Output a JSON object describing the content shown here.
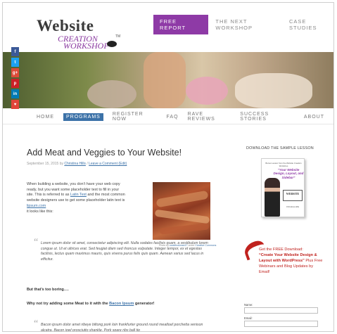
{
  "header": {
    "logo_main": "Website",
    "logo_sub1": "CREATION",
    "logo_sub2": "WORKSHOP",
    "logo_tm": "TM",
    "free_report": "FREE REPORT",
    "top_links": [
      "THE NEXT WORKSHOP",
      "CASE STUDIES"
    ]
  },
  "social": [
    {
      "label": "f",
      "color": "#3b5998"
    },
    {
      "label": "t",
      "color": "#1da1f2"
    },
    {
      "label": "g+",
      "color": "#dd4b39"
    },
    {
      "label": "p",
      "color": "#cb2027"
    },
    {
      "label": "in",
      "color": "#007bb5"
    },
    {
      "label": "♥",
      "color": "#e0443a"
    }
  ],
  "nav": {
    "items": [
      "HOME",
      "PROGRAMS",
      "REGISTER NOW",
      "FAQ",
      "RAVE REVIEWS",
      "SUCCESS STORIES",
      "ABOUT"
    ],
    "active": "PROGRAMS"
  },
  "post": {
    "title": "Add Meat and Veggies to Your Website!",
    "date": "September 15, 2015 by",
    "author": "Christina Hills",
    "sep": "/",
    "comment_link": "Leave a Comment (Edit)",
    "p1_a": "When building a website, you don’t have your web copy ready, but you want some placeholder text to fill in your site. This is referred to as",
    "p1_link1": "Latin Text",
    "p1_b": "and the most common website designers use to get some placeholder latin text is",
    "p1_link2": "lipsum.com",
    "p1_c": "it looks like this:",
    "quote1": "Lorem ipsum dolor sit amet, consectetur adipiscing elit. Nulla sodales facilisis quam, a vestibulum lorem congue ut. Ut et ultrices erat. Sed feugiat diam sed rhoncus vulputate. Integer tempor, ex et egestas facilisis, lectus quam maximus mauris, quis viverra purus felis quis quam. Aenean varius sed lacus in efficitur.",
    "boring": "But that’s too boring….",
    "why_a": "Why not try adding some Meat to it with the",
    "why_link": "Bacon Ipsum",
    "why_b": "generator!",
    "quote2": "Bacon ipsum dolor amet ribeye biltong pork loin frankfurter ground round meatloaf porchetta venison alcatra. Bacon jowl prosciutto shankle. Pork spare ribs ball tip",
    "caption_a": "Photo by",
    "caption_link": "cookbookman17",
    "caption_b": "under",
    "caption_link2": "Creative Commons"
  },
  "sidebar": {
    "heading": "DOWNLOAD THE SAMPLE LESSON",
    "book_top": "Bonus Lesson from the Website Creation Workshop",
    "book_quote": "“Your Website Design, Layout, and Sidebar”",
    "book_logo": "WEBSITE",
    "book_credit": "Christina Hills",
    "promo_a": "Get the FREE Download:",
    "promo_b": "“Create Your Website Design & Layout with WordPress”",
    "promo_c": "Plus Free Webinars and Blog Updates by Email!",
    "name_label": "Name:",
    "email_label": "Email:"
  }
}
